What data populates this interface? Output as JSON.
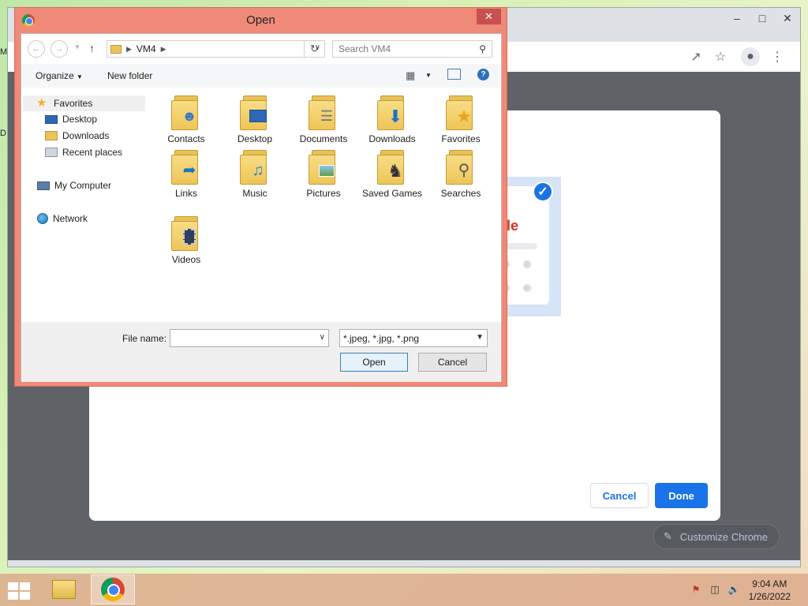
{
  "desktop": {
    "letters": [
      "M",
      "D"
    ]
  },
  "chrome": {
    "modal": {
      "theme_preview_text": "le",
      "cancel_label": "Cancel",
      "done_label": "Done"
    },
    "customize_label": "Customize Chrome"
  },
  "dialog": {
    "title": "Open",
    "breadcrumb": "VM4",
    "search_placeholder": "Search VM4",
    "organize_label": "Organize",
    "new_folder_label": "New folder",
    "nav": {
      "favorites": "Favorites",
      "desktop": "Desktop",
      "downloads": "Downloads",
      "recent": "Recent places",
      "computer": "My Computer",
      "network": "Network"
    },
    "files": [
      {
        "label": "Contacts",
        "icon": "contacts-folder-icon"
      },
      {
        "label": "Desktop",
        "icon": "desktop-folder-icon"
      },
      {
        "label": "Documents",
        "icon": "documents-folder-icon"
      },
      {
        "label": "Downloads",
        "icon": "downloads-folder-icon"
      },
      {
        "label": "Favorites",
        "icon": "favorites-folder-icon"
      },
      {
        "label": "Links",
        "icon": "links-folder-icon"
      },
      {
        "label": "Music",
        "icon": "music-folder-icon"
      },
      {
        "label": "Pictures",
        "icon": "pictures-folder-icon"
      },
      {
        "label": "Saved Games",
        "icon": "saved-games-folder-icon"
      },
      {
        "label": "Searches",
        "icon": "searches-folder-icon"
      },
      {
        "label": "Videos",
        "icon": "videos-folder-icon"
      }
    ],
    "file_name_label": "File name:",
    "file_name_value": "",
    "file_type_value": "*.jpeg, *.jpg, *.png",
    "open_label": "Open",
    "cancel_label": "Cancel"
  },
  "taskbar": {
    "time": "9:04 AM",
    "date": "1/26/2022"
  },
  "colors": {
    "accent": "#1a73e8",
    "dialog_frame": "#f08a78",
    "close_button": "#c75050"
  }
}
